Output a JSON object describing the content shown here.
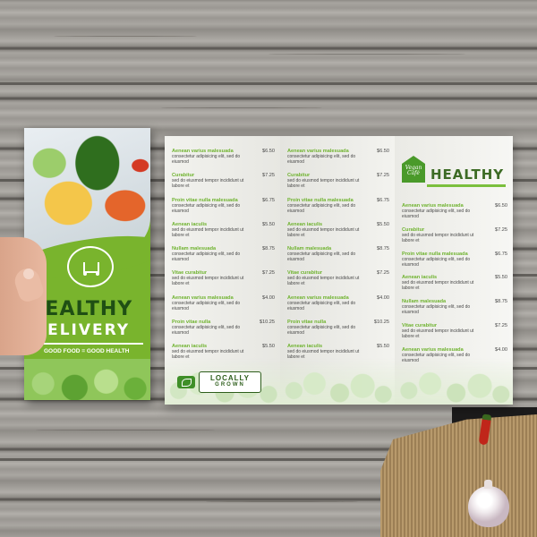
{
  "scene": "brochure-on-wood",
  "colors": {
    "brand_green": "#79b42d",
    "dark_green": "#1f4f14",
    "item_green": "#6fb32f",
    "wood": "#a09d98"
  },
  "cover": {
    "title": "HEALTHY",
    "subtitle": "DELIVERY",
    "tagline": "GOOD FOOD = GOOD HEALTH",
    "icon": "cart-icon"
  },
  "brand": {
    "logo_text": "Vegan Café",
    "title": "HEALTHY"
  },
  "badge": {
    "top": "LOCALLY",
    "bottom": "GROWN"
  },
  "menu": {
    "left": [
      {
        "name": "Aenean varius malesuada",
        "desc": "consectetur adipisicing elit, sed do eiusmod",
        "price": "$6.50"
      },
      {
        "name": "Curabitur",
        "desc": "sed do eiusmod tempor incididunt ut labore et",
        "price": "$7.25"
      },
      {
        "name": "Proin vitae nulla malesuada",
        "desc": "consectetur adipisicing elit, sed do eiusmod",
        "price": "$6.75"
      },
      {
        "name": "Aenean iaculis",
        "desc": "sed do eiusmod tempor incididunt ut labore et",
        "price": "$5.50"
      },
      {
        "name": "Nullam malesuada",
        "desc": "consectetur adipisicing elit, sed do eiusmod",
        "price": "$8.75"
      },
      {
        "name": "Vitae curabitur",
        "desc": "sed do eiusmod tempor incididunt ut labore et",
        "price": "$7.25"
      },
      {
        "name": "Aenean varius malesuada",
        "desc": "consectetur adipisicing elit, sed do eiusmod",
        "price": "$4.00"
      },
      {
        "name": "Proin vitae nulla",
        "desc": "consectetur adipisicing elit, sed do eiusmod",
        "price": "$10.25"
      },
      {
        "name": "Aenean iaculis",
        "desc": "sed do eiusmod tempor incididunt ut labore et",
        "price": "$5.50"
      }
    ],
    "middle": [
      {
        "name": "Aenean varius malesuada",
        "desc": "consectetur adipisicing elit, sed do eiusmod",
        "price": "$6.50"
      },
      {
        "name": "Curabitur",
        "desc": "sed do eiusmod tempor incididunt ut labore et",
        "price": "$7.25"
      },
      {
        "name": "Proin vitae nulla malesuada",
        "desc": "consectetur adipisicing elit, sed do eiusmod",
        "price": "$6.75"
      },
      {
        "name": "Aenean iaculis",
        "desc": "sed do eiusmod tempor incididunt ut labore et",
        "price": "$5.50"
      },
      {
        "name": "Nullam malesuada",
        "desc": "consectetur adipisicing elit, sed do eiusmod",
        "price": "$8.75"
      },
      {
        "name": "Vitae curabitur",
        "desc": "sed do eiusmod tempor incididunt ut labore et",
        "price": "$7.25"
      },
      {
        "name": "Aenean varius malesuada",
        "desc": "consectetur adipisicing elit, sed do eiusmod",
        "price": "$4.00"
      },
      {
        "name": "Proin vitae nulla",
        "desc": "consectetur adipisicing elit, sed do eiusmod",
        "price": "$10.25"
      },
      {
        "name": "Aenean iaculis",
        "desc": "sed do eiusmod tempor incididunt ut labore et",
        "price": "$5.50"
      }
    ],
    "right": [
      {
        "name": "Aenean varius malesuada",
        "desc": "consectetur adipisicing elit, sed do eiusmod",
        "price": "$6.50"
      },
      {
        "name": "Curabitur",
        "desc": "sed do eiusmod tempor incididunt ut labore et",
        "price": "$7.25"
      },
      {
        "name": "Proin vitae nulla malesuada",
        "desc": "consectetur adipisicing elit, sed do eiusmod",
        "price": "$6.75"
      },
      {
        "name": "Aenean iaculis",
        "desc": "sed do eiusmod tempor incididunt ut labore et",
        "price": "$5.50"
      },
      {
        "name": "Nullam malesuada",
        "desc": "consectetur adipisicing elit, sed do eiusmod",
        "price": "$8.75"
      },
      {
        "name": "Vitae curabitur",
        "desc": "sed do eiusmod tempor incididunt ut labore et",
        "price": "$7.25"
      },
      {
        "name": "Aenean varius malesuada",
        "desc": "consectetur adipisicing elit, sed do eiusmod",
        "price": "$4.00"
      }
    ]
  }
}
